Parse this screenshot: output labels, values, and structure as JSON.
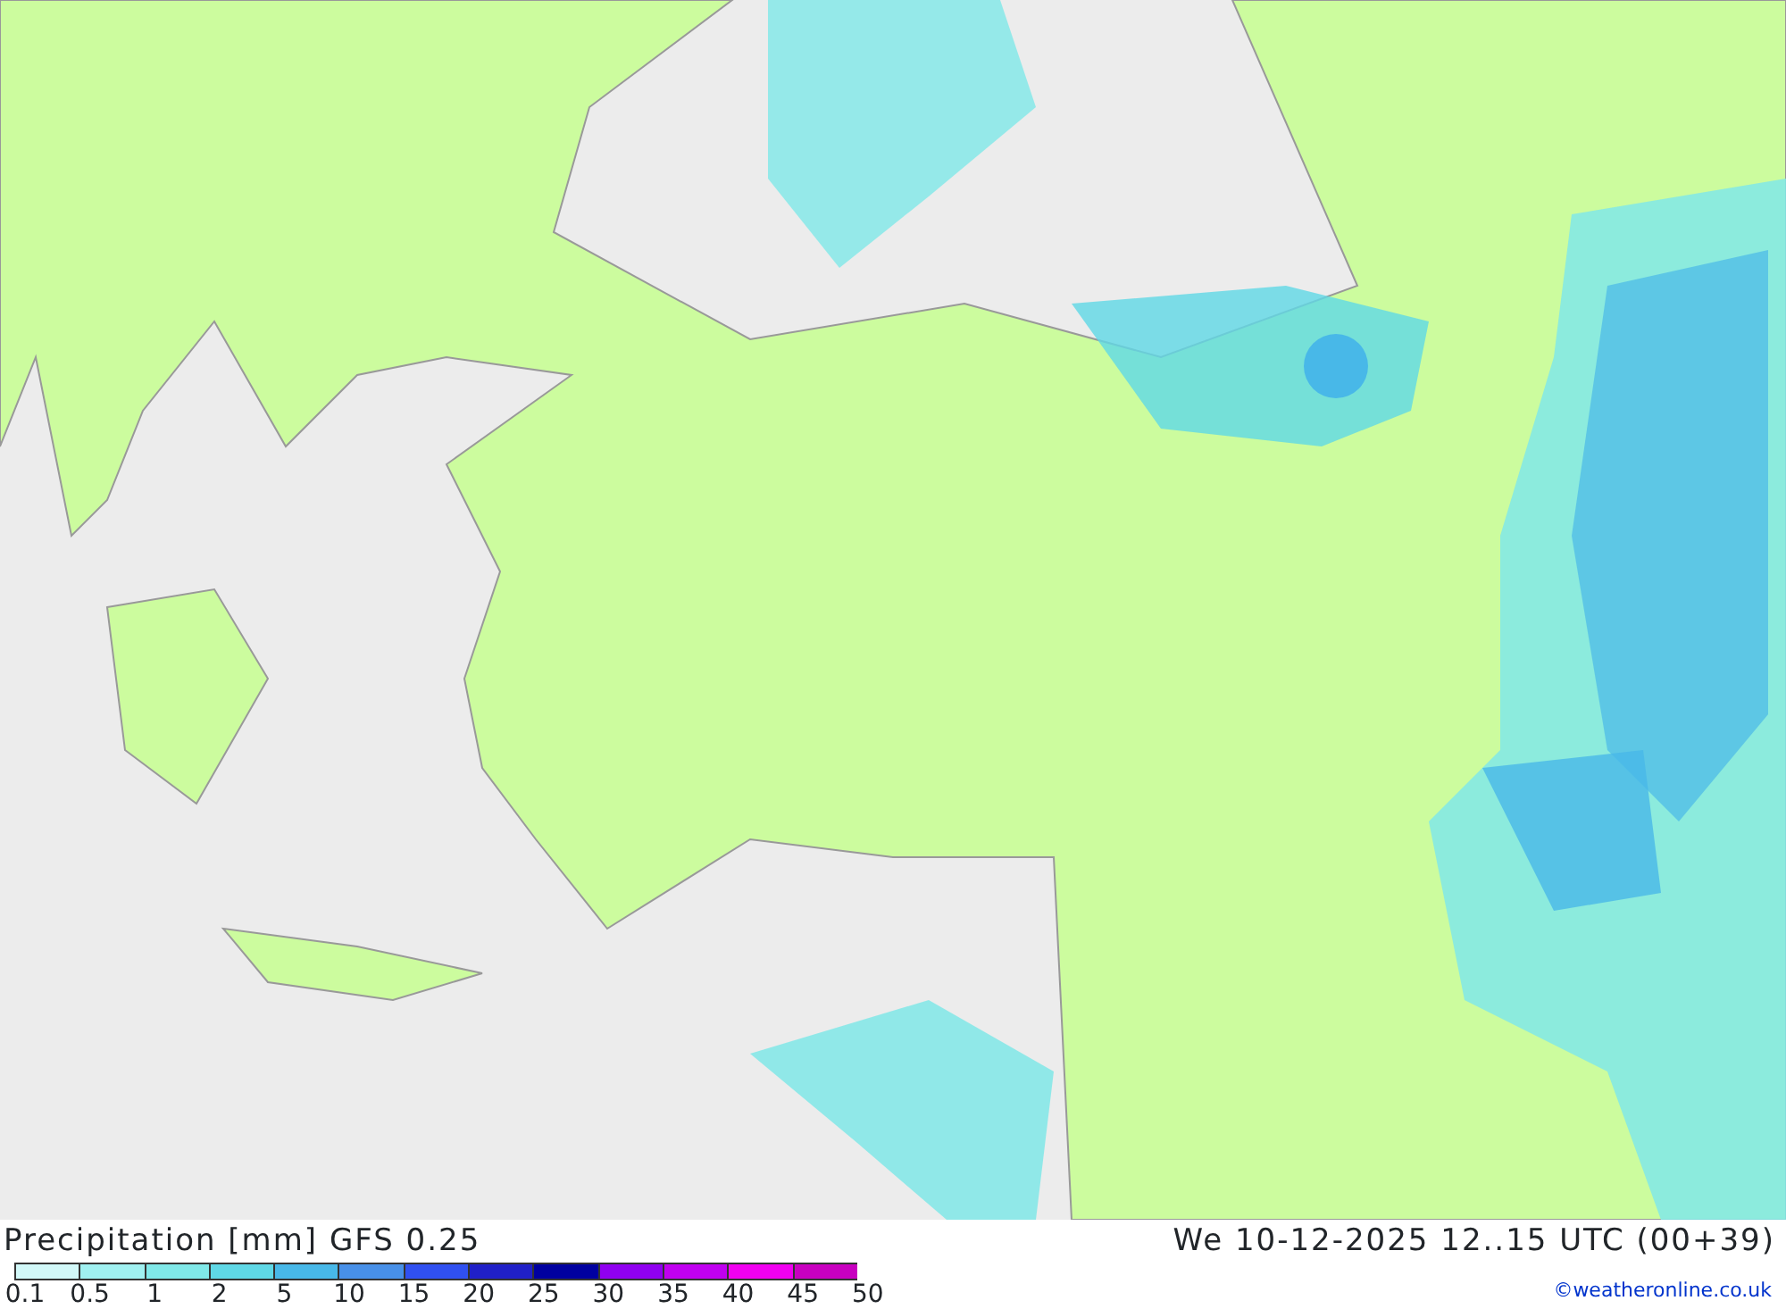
{
  "title": "Precipitation [mm] GFS 0.25",
  "valid_time": "We 10-12-2025 12..15 UTC (00+39)",
  "legend": {
    "colors": [
      {
        "color": "#d2f8f8"
      },
      {
        "color": "#a0f0f0"
      },
      {
        "color": "#80e8e8"
      },
      {
        "color": "#5fd8e6"
      },
      {
        "color": "#48b8e8"
      },
      {
        "color": "#4890e8"
      },
      {
        "color": "#3050f0"
      },
      {
        "color": "#2020c8"
      },
      {
        "color": "#0000a0"
      },
      {
        "color": "#9000f0"
      },
      {
        "color": "#c000f0"
      },
      {
        "color": "#f000f0"
      },
      {
        "color": "#c800c0"
      }
    ],
    "labels": [
      "0.1",
      "0.5",
      "1",
      "2",
      "5",
      "10",
      "15",
      "20",
      "25",
      "30",
      "35",
      "40",
      "45",
      "50"
    ]
  },
  "credit": "©weatheronline.co.uk"
}
